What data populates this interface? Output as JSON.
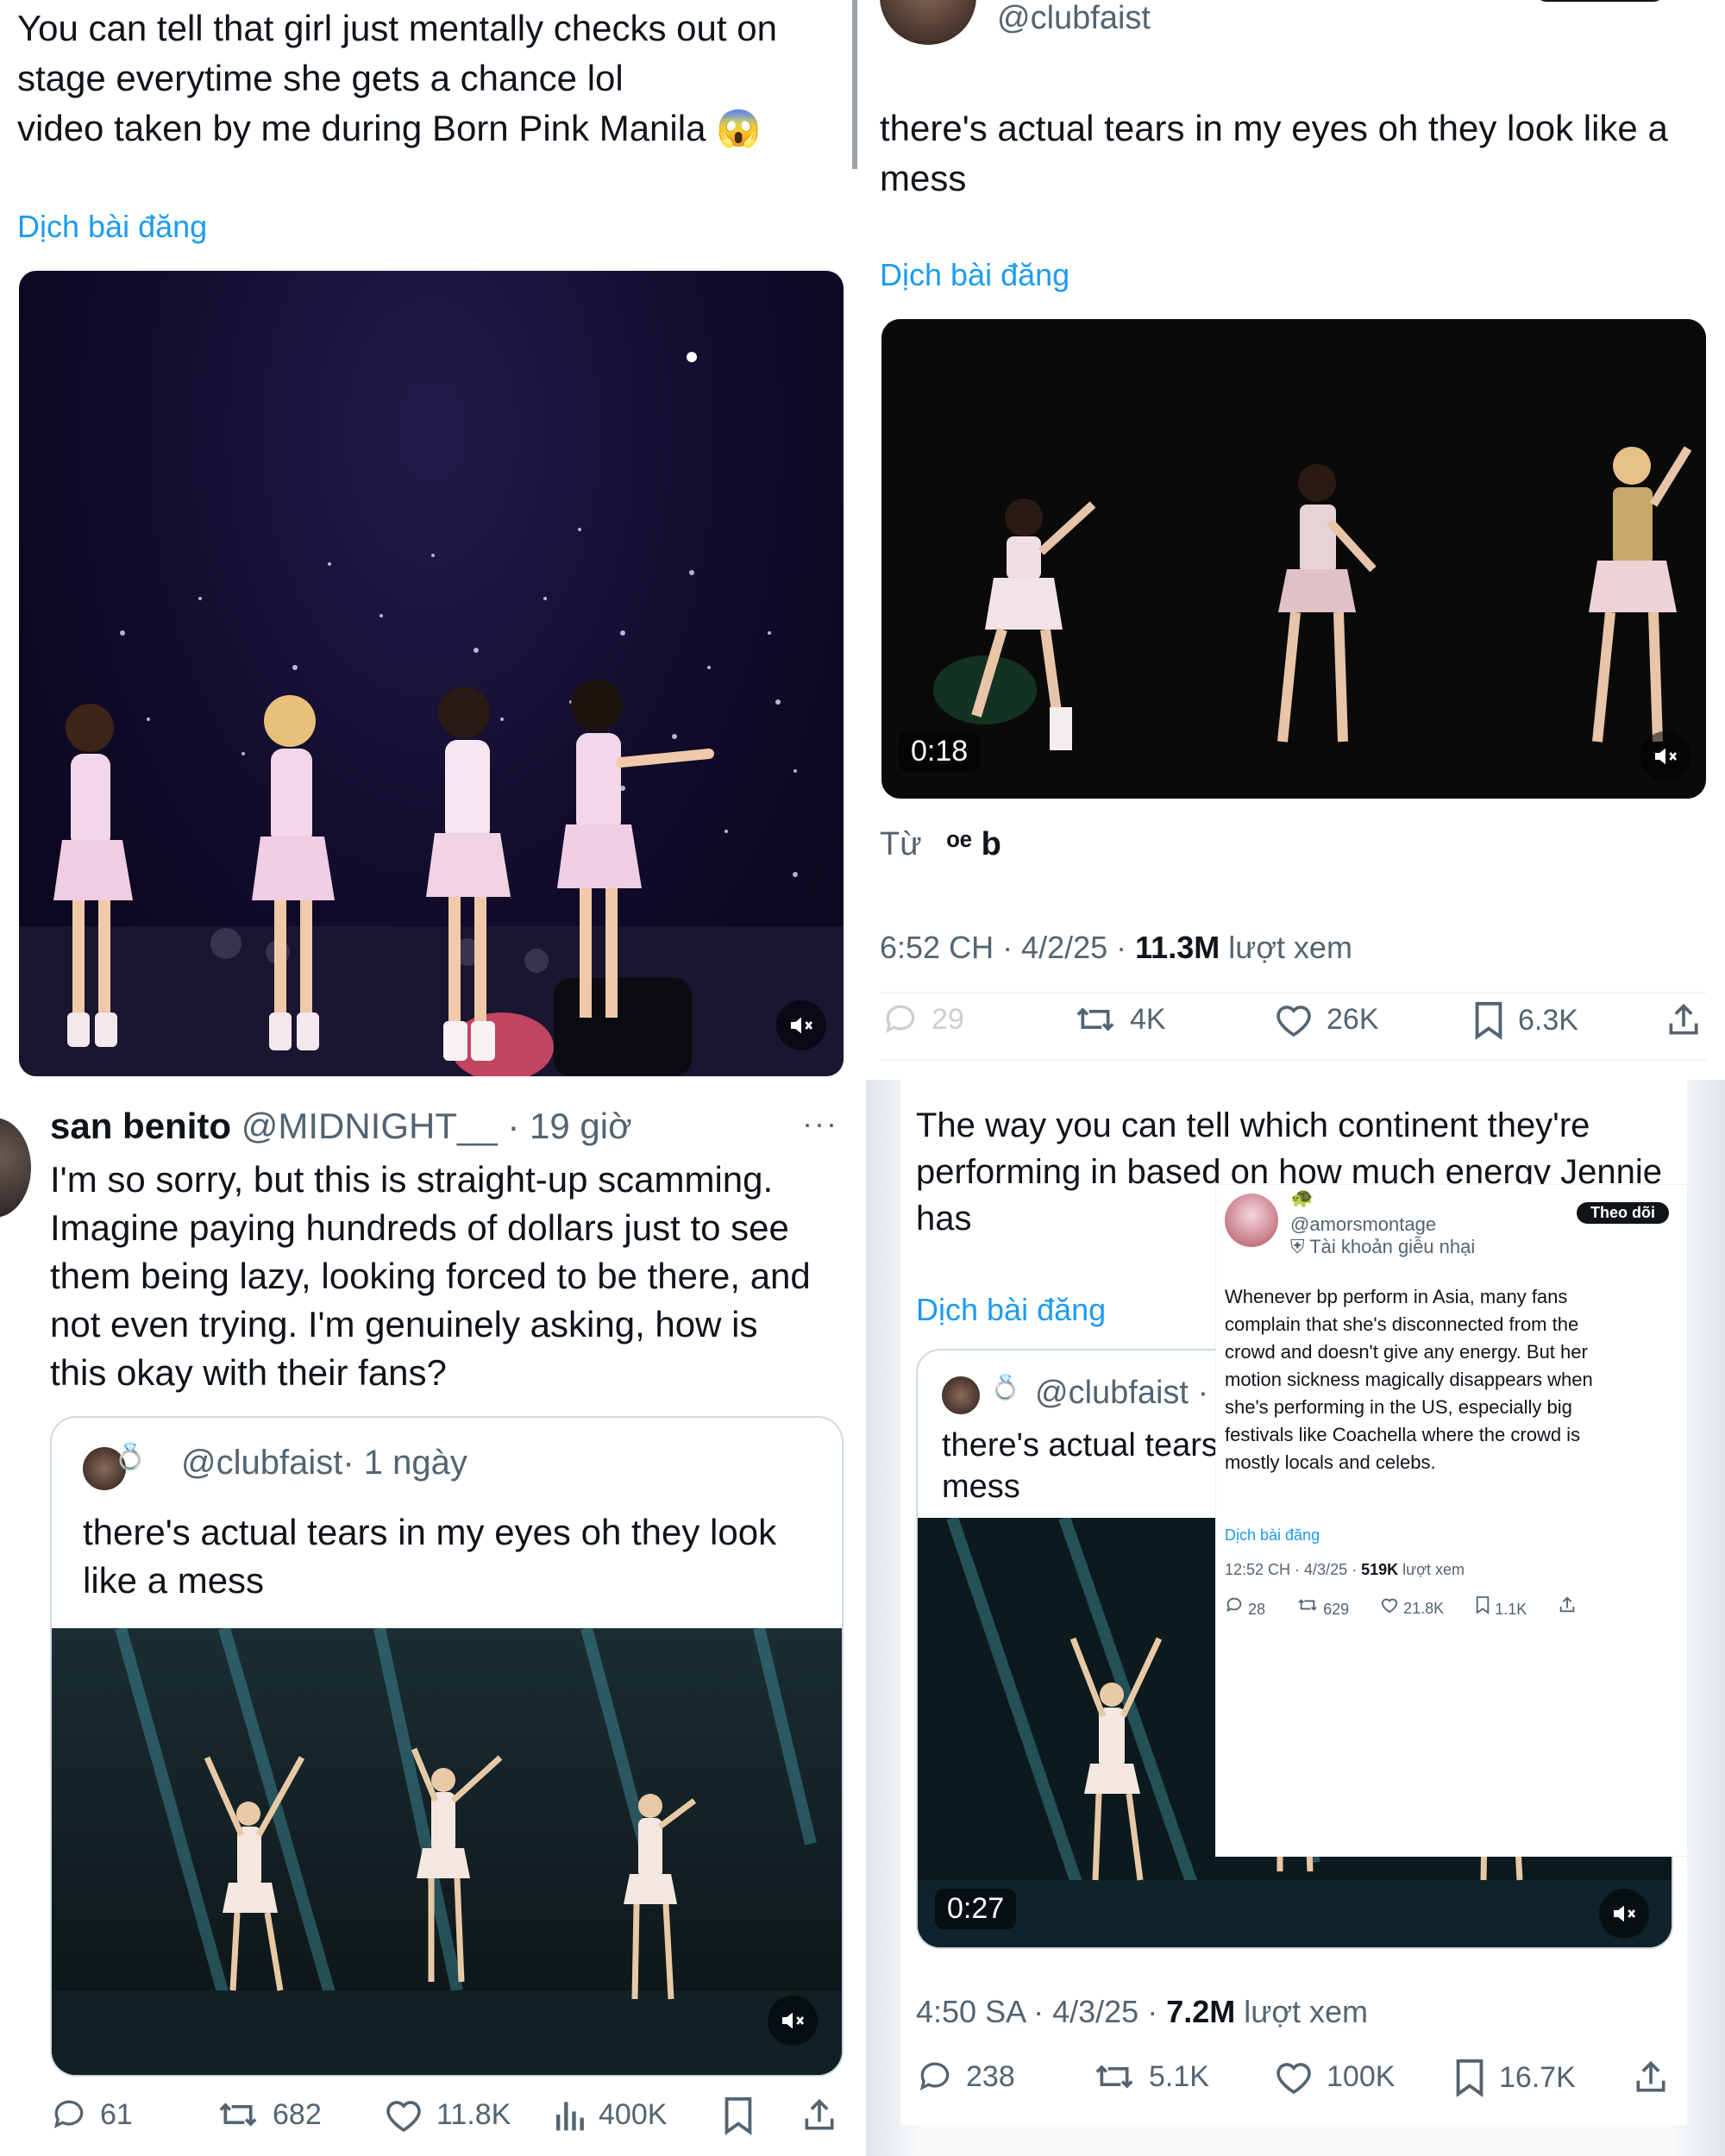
{
  "panel1": {
    "text_line1": "You can tell that girl just mentally checks out on",
    "text_line2": "stage everytime she gets a chance lol",
    "text_line3": "video taken by me during Born Pink Manila",
    "emoji": "😱",
    "translate": "Dịch bài đăng"
  },
  "panel2": {
    "handle": "@clubfaist",
    "text_line1": "there's actual tears in my eyes oh they look like a",
    "text_line2": "mess",
    "translate": "Dịch bài đăng",
    "duration": "0:18",
    "from_label": "Từ",
    "from_name": "ᵒᵉ b",
    "timestamp": "6:52 CH · 4/2/25 · ",
    "views_count": "11.3M",
    "views_label": " lượt xem",
    "replies": "29",
    "reposts": "4K",
    "likes": "26K",
    "bookmarks": "6.3K"
  },
  "panel3": {
    "name": "san benito",
    "handle": "@MIDNIGHT__",
    "time": "· 19 giờ",
    "more": "···",
    "text": [
      "I'm so sorry, but this is straight-up scamming.",
      "Imagine paying hundreds of dollars just to see",
      "them being lazy, looking forced to be there, and",
      "not even trying. I'm genuinely asking, how is",
      "this okay with their fans?"
    ],
    "quote": {
      "handle": "@clubfaist",
      "time": "· 1 ngày",
      "text_line1": "there's actual tears in my eyes oh they look",
      "text_line2": "like a mess"
    },
    "replies": "61",
    "reposts": "682",
    "likes": "11.8K",
    "views": "400K"
  },
  "panel4": {
    "text": [
      "The way you can tell which continent they're",
      "performing in based on how much energy Jennie",
      "has"
    ],
    "translate": "Dịch bài đăng",
    "quote": {
      "handle": "@clubfaist ·",
      "text_line1": "there's actual tears i",
      "text_line2": "mess"
    },
    "duration": "0:27",
    "timestamp": "4:50 SA · 4/3/25 · ",
    "views_count": "7.2M",
    "views_label": " lượt xem",
    "replies": "238",
    "reposts": "5.1K",
    "likes": "100K",
    "bookmarks": "16.7K",
    "overlay": {
      "handle": "@amorsmontage",
      "badge": "Tài khoản giễu nhại",
      "follow": "Theo dõi",
      "text": [
        "Whenever bp perform in Asia, many fans",
        "complain that she's disconnected from the",
        "crowd and doesn't give any energy. But her",
        "motion sickness magically disappears when",
        "she's performing in the US, especially big",
        "festivals like Coachella where the crowd is",
        "mostly locals and celebs."
      ],
      "translate": "Dịch bài đăng",
      "timestamp": "12:52 CH · 4/3/25 · ",
      "views_count": "519K",
      "views_label": " lượt xem",
      "replies": "28",
      "reposts": "629",
      "likes": "21.8K",
      "bookmarks": "1.1K"
    }
  },
  "colors": {
    "link": "#1d9bf0",
    "muted": "#536471",
    "text": "#0f1419",
    "border": "#cfd9de"
  }
}
